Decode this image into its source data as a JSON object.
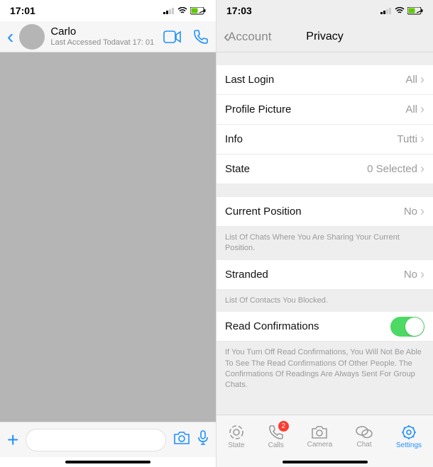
{
  "left": {
    "status": {
      "time": "17:01"
    },
    "header": {
      "name": "Carlo",
      "subtitle": "Last Accessed Todavat 17: 01"
    },
    "input": {
      "placeholder": ""
    }
  },
  "right": {
    "status": {
      "time": "17:03"
    },
    "nav": {
      "back_label": "Account",
      "title": "Privacy"
    },
    "rows": {
      "last_login": {
        "label": "Last Login",
        "value": "All"
      },
      "profile_picture": {
        "label": "Profile Picture",
        "value": "All"
      },
      "info": {
        "label": "Info",
        "value": "Tutti"
      },
      "state": {
        "label": "State",
        "value": "0 Selected"
      },
      "current_position": {
        "label": "Current Position",
        "value": "No"
      },
      "stranded": {
        "label": "Stranded",
        "value": "No"
      },
      "read_confirmations": {
        "label": "Read Confirmations",
        "on": true
      }
    },
    "footers": {
      "position": "List Of Chats Where You Are Sharing Your Current Position.",
      "stranded": "List Of Contacts You Blocked.",
      "read": "If You Turn Off Read Confirmations, You Will Not Be Able To See The Read Confirmations Of Other People. The Confirmations Of Readings Are Always Sent For Group Chats."
    },
    "tabs": {
      "state": "State",
      "calls": "Calls",
      "calls_badge": "2",
      "camera": "Camera",
      "chat": "Chat",
      "settings": "Settings"
    }
  }
}
